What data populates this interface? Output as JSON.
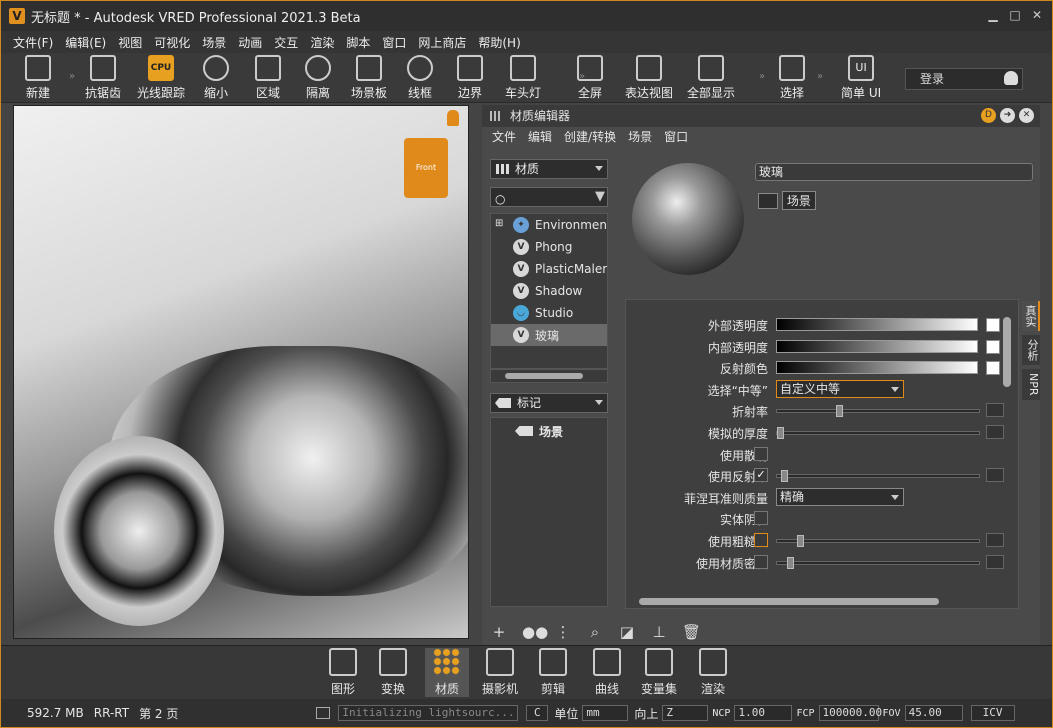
{
  "window": {
    "title": "无标题 * - Autodesk VRED Professional 2021.3 Beta",
    "logo_letter": "V"
  },
  "menu": [
    "文件(F)",
    "编辑(E)",
    "视图",
    "可视化",
    "场景",
    "动画",
    "交互",
    "渲染",
    "脚本",
    "窗口",
    "网上商店",
    "帮助(H)"
  ],
  "toolbar": [
    {
      "label": "新建",
      "icon": "new-file-icon"
    },
    {
      "label": "抗锯齿",
      "icon": "antialias-icon"
    },
    {
      "label": "光线跟踪",
      "icon": "cpu-icon",
      "icon_text": "CPU"
    },
    {
      "label": "缩小",
      "icon": "half-circle-icon"
    },
    {
      "label": "区域",
      "icon": "region-icon"
    },
    {
      "label": "隔离",
      "icon": "eye-icon"
    },
    {
      "label": "场景板",
      "icon": "sceneplate-icon"
    },
    {
      "label": "线框",
      "icon": "wireframe-icon"
    },
    {
      "label": "边界",
      "icon": "boundary-icon"
    },
    {
      "label": "车头灯",
      "icon": "headlight-icon"
    },
    {
      "label": "全屏",
      "icon": "fullscreen-icon"
    },
    {
      "label": "表达视图",
      "icon": "presentation-icon"
    },
    {
      "label": "全部显示",
      "icon": "show-all-icon"
    },
    {
      "label": "选择",
      "icon": "select-icon"
    },
    {
      "label": "简单 UI",
      "icon": "simple-ui-icon",
      "icon_text": "UI"
    }
  ],
  "login": {
    "label": "登录"
  },
  "viewport": {
    "gizmo_text": "Front"
  },
  "material_editor": {
    "title": "材质编辑器",
    "menu": [
      "文件",
      "编辑",
      "创建/转换",
      "场景",
      "窗口"
    ],
    "filter_dropdown": "材质",
    "materials": [
      {
        "name": "Environment",
        "icon": "environment-icon"
      },
      {
        "name": "Phong",
        "icon": "vred-ball-icon"
      },
      {
        "name": "PlasticMaler",
        "icon": "vred-ball-icon"
      },
      {
        "name": "Shadow",
        "icon": "vred-ball-icon"
      },
      {
        "name": "Studio",
        "icon": "studio-icon"
      },
      {
        "name": "玻璃",
        "icon": "vred-ball-icon",
        "selected": true
      }
    ],
    "tag_dropdown": "标记",
    "tag_tree_item": "场景",
    "material_name": "玻璃",
    "scene_tag": "场景",
    "side_tabs": [
      "真实",
      "分析",
      "NPR"
    ],
    "properties": [
      {
        "label": "外部透明度",
        "type": "gradient"
      },
      {
        "label": "内部透明度",
        "type": "gradient"
      },
      {
        "label": "反射颜色",
        "type": "gradient"
      },
      {
        "label": "选择“中等”",
        "type": "combo",
        "value": "自定义中等",
        "highlight": true
      },
      {
        "label": "折射率",
        "type": "slider",
        "knob": 0.3
      },
      {
        "label": "模拟的厚度",
        "type": "slider",
        "knob": 0.0
      },
      {
        "label": "使用散射",
        "type": "checkbox",
        "checked": false
      },
      {
        "label": "使用反射率",
        "type": "checkbox-slider",
        "checked": true,
        "knob": 0.02
      },
      {
        "label": "菲涅耳准则质量",
        "type": "combo",
        "value": "精确"
      },
      {
        "label": "实体阴影",
        "type": "checkbox",
        "checked": false
      },
      {
        "label": "使用粗糙度",
        "type": "checkbox-slider",
        "checked": false,
        "highlight": true,
        "knob": 0.1
      },
      {
        "label": "使用材质密度",
        "type": "checkbox-slider",
        "checked": false,
        "knob": 0.05
      }
    ],
    "tools": [
      "+",
      "●●",
      "⋮",
      "⌕",
      "◪",
      "⊥",
      "🗑"
    ]
  },
  "modules": [
    {
      "label": "图形",
      "icon": "graph-icon"
    },
    {
      "label": "变换",
      "icon": "transform-icon"
    },
    {
      "label": "材质",
      "icon": "material-icon",
      "active": true
    },
    {
      "label": "摄影机",
      "icon": "camera-icon"
    },
    {
      "label": "剪辑",
      "icon": "clip-icon"
    },
    {
      "label": "曲线",
      "icon": "curve-icon"
    },
    {
      "label": "变量集",
      "icon": "variant-icon"
    },
    {
      "label": "渲染",
      "icon": "render-icon"
    }
  ],
  "status": {
    "memory": "592.7 MB",
    "mode": "RR-RT",
    "page": "第 2 页",
    "console": "Initializing lightsourc...",
    "console_btn": "C",
    "unit_label": "单位",
    "unit": "mm",
    "up_label": "向上",
    "up": "Z",
    "ncp_label": "NCP",
    "ncp": "1.00",
    "fcp_label": "FCP",
    "fcp": "100000.00",
    "fov_label": "FOV",
    "fov": "45.00",
    "icv": "ICV"
  }
}
